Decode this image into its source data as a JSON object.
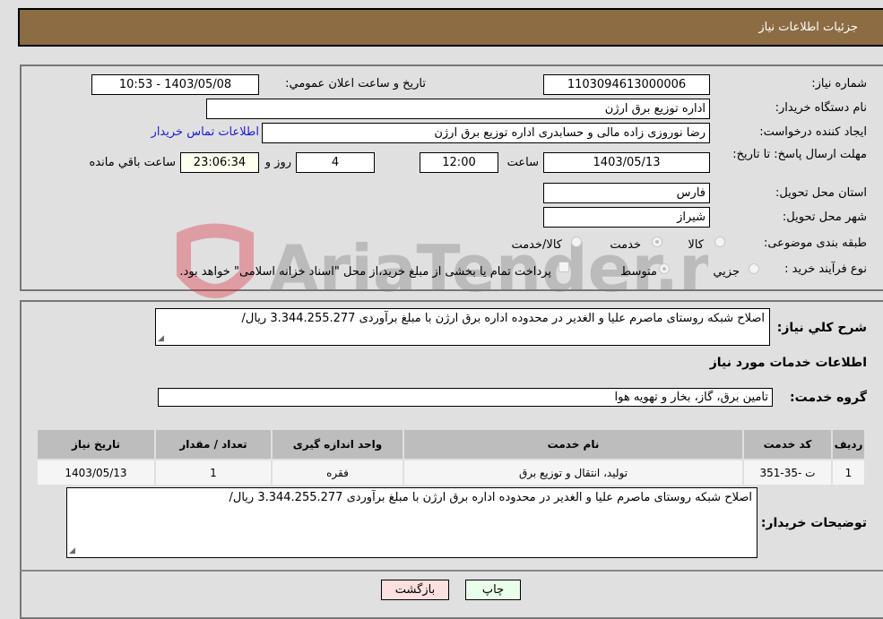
{
  "header": {
    "title": "جزئیات اطلاعات نیاز"
  },
  "form": {
    "need_number": {
      "label": "شماره نیاز:",
      "value": "1103094613000006"
    },
    "announce_datetime": {
      "label": "تاریخ و ساعت اعلان عمومي:",
      "value": "1403/05/08 - 10:53"
    },
    "buyer_org": {
      "label": "نام دستگاه خریدار:",
      "value": "اداره توزیع برق ارژن"
    },
    "requester": {
      "label": "ایجاد کننده درخواست:",
      "value": "رضا نوروزی زاده مالی و حسابدری اداره توزیع برق ارژن"
    },
    "buyer_contact_link": "اطلاعات تماس خریدار",
    "deadline": {
      "label": "مهلت ارسال پاسخ: تا تاریخ:",
      "date": "1403/05/13",
      "time_label": "ساعت",
      "time": "12:00",
      "days": "4",
      "days_label": "روز و",
      "remaining": "23:06:34",
      "remaining_label": "ساعت باقي مانده"
    },
    "province": {
      "label": "استان محل تحویل:",
      "value": "فارس"
    },
    "city": {
      "label": "شهر محل تحویل:",
      "value": "شیراز"
    },
    "category": {
      "label": "طبقه بندی موضوعی:",
      "options": [
        {
          "label": "کالا",
          "checked": false
        },
        {
          "label": "خدمت",
          "checked": true
        },
        {
          "label": "کالا/خدمت",
          "checked": false
        }
      ]
    },
    "purchase_type": {
      "label": "نوع فرآیند خرید :",
      "options": [
        {
          "label": "جزيي",
          "checked": false
        },
        {
          "label": "متوسط",
          "checked": true
        }
      ],
      "treasury_note": "پرداخت تمام یا بخشی از مبلغ خرید،از محل \"اسناد خزانه اسلامی\" خواهد بود."
    }
  },
  "details": {
    "general_desc_label": "شرح کلي نياز:",
    "general_desc": "اصلاح شبکه روستای ماصرم علیا و الغدیر در محدوده اداره برق ارژن با مبلغ برآوردی 3.344.255.277 ریال/",
    "services_heading": "اطلاعات خدمات مورد نیاز",
    "service_group_label": "گروه خدمت:",
    "service_group": "تامین برق، گاز، بخار و تهویه هوا",
    "table": {
      "headers": [
        "ردیف",
        "کد خدمت",
        "نام خدمت",
        "واحد اندازه گیری",
        "تعداد / مقدار",
        "تاریخ نیاز"
      ],
      "rows": [
        [
          "1",
          "ت -35-351",
          "تولید، انتقال و توزیع برق",
          "فقره",
          "1",
          "1403/05/13"
        ]
      ]
    },
    "buyer_notes_label": "توضیحات خریدار:",
    "buyer_notes": "اصلاح شبکه روستای ماصرم علیا و الغدیر در محدوده اداره برق ارژن با مبلغ برآوردی 3.344.255.277 ریال/"
  },
  "buttons": {
    "print": "چاپ",
    "back": "بازگشت"
  },
  "watermark": "AriaTender.neT"
}
